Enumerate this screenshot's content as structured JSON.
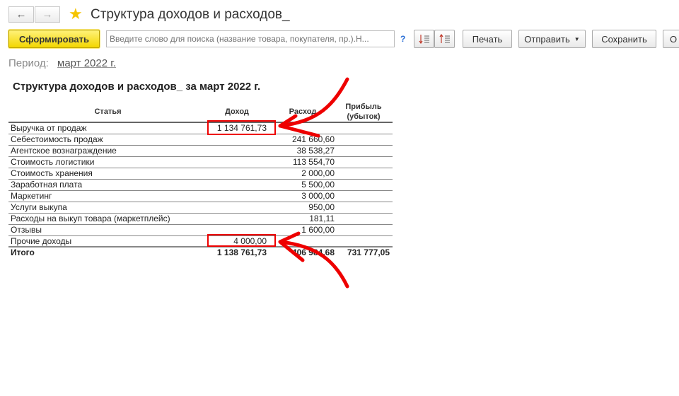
{
  "window": {
    "title": "Структура доходов и расходов_",
    "back_icon": "arrow-left-icon",
    "forward_icon": "arrow-right-icon",
    "favorite_icon": "star-icon"
  },
  "toolbar": {
    "generate_label": "Сформировать",
    "search_placeholder": "Введите слово для поиска (название товара, покупателя, пр.).Н...",
    "help_label": "?",
    "print_label": "Печать",
    "send_label": "Отправить",
    "save_label": "Сохранить",
    "more_label": "О"
  },
  "period": {
    "label": "Период:",
    "value": "март 2022 г."
  },
  "report": {
    "title": "Структура доходов и расходов_ за март 2022 г.",
    "columns": {
      "item": "Статья",
      "income": "Доход",
      "expense": "Расход",
      "profit_line1": "Прибыль",
      "profit_line2": "(убыток)"
    },
    "rows": [
      {
        "name": "Выручка от продаж",
        "income": "1 134 761,73",
        "expense": "",
        "profit": ""
      },
      {
        "name": "Себестоимость продаж",
        "income": "",
        "expense": "241 660,60",
        "profit": ""
      },
      {
        "name": "Агентское вознаграждение",
        "income": "",
        "expense": "38 538,27",
        "profit": ""
      },
      {
        "name": "Стоимость логистики",
        "income": "",
        "expense": "113 554,70",
        "profit": ""
      },
      {
        "name": "Стоимость хранения",
        "income": "",
        "expense": "2 000,00",
        "profit": ""
      },
      {
        "name": "Заработная плата",
        "income": "",
        "expense": "5 500,00",
        "profit": ""
      },
      {
        "name": "Маркетинг",
        "income": "",
        "expense": "3 000,00",
        "profit": ""
      },
      {
        "name": "Услуги выкупа",
        "income": "",
        "expense": "950,00",
        "profit": ""
      },
      {
        "name": "Расходы на выкуп товара (маркетплейс)",
        "income": "",
        "expense": "181,11",
        "profit": ""
      },
      {
        "name": "Отзывы",
        "income": "",
        "expense": "1 600,00",
        "profit": ""
      },
      {
        "name": "Прочие доходы",
        "income": "4 000,00",
        "expense": "",
        "profit": ""
      }
    ],
    "total": {
      "name": "Итого",
      "income": "1 138 761,73",
      "expense": "406 984,68",
      "profit": "731 777,05"
    }
  },
  "annotation_color": "#e00000"
}
